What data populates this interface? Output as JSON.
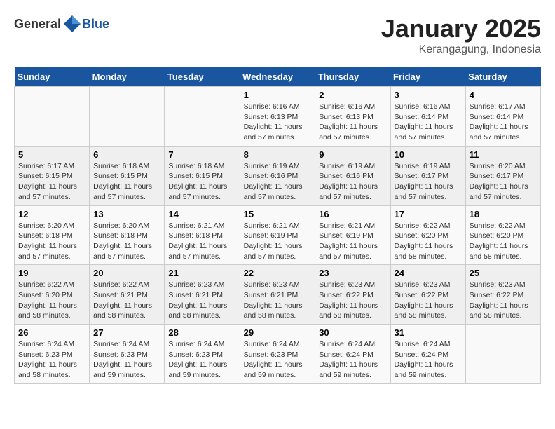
{
  "logo": {
    "general": "General",
    "blue": "Blue"
  },
  "title": "January 2025",
  "subtitle": "Kerangagung, Indonesia",
  "days_of_week": [
    "Sunday",
    "Monday",
    "Tuesday",
    "Wednesday",
    "Thursday",
    "Friday",
    "Saturday"
  ],
  "weeks": [
    [
      {
        "day": "",
        "sunrise": "",
        "sunset": "",
        "daylight": ""
      },
      {
        "day": "",
        "sunrise": "",
        "sunset": "",
        "daylight": ""
      },
      {
        "day": "",
        "sunrise": "",
        "sunset": "",
        "daylight": ""
      },
      {
        "day": "1",
        "sunrise": "Sunrise: 6:16 AM",
        "sunset": "Sunset: 6:13 PM",
        "daylight": "Daylight: 11 hours and 57 minutes."
      },
      {
        "day": "2",
        "sunrise": "Sunrise: 6:16 AM",
        "sunset": "Sunset: 6:13 PM",
        "daylight": "Daylight: 11 hours and 57 minutes."
      },
      {
        "day": "3",
        "sunrise": "Sunrise: 6:16 AM",
        "sunset": "Sunset: 6:14 PM",
        "daylight": "Daylight: 11 hours and 57 minutes."
      },
      {
        "day": "4",
        "sunrise": "Sunrise: 6:17 AM",
        "sunset": "Sunset: 6:14 PM",
        "daylight": "Daylight: 11 hours and 57 minutes."
      }
    ],
    [
      {
        "day": "5",
        "sunrise": "Sunrise: 6:17 AM",
        "sunset": "Sunset: 6:15 PM",
        "daylight": "Daylight: 11 hours and 57 minutes."
      },
      {
        "day": "6",
        "sunrise": "Sunrise: 6:18 AM",
        "sunset": "Sunset: 6:15 PM",
        "daylight": "Daylight: 11 hours and 57 minutes."
      },
      {
        "day": "7",
        "sunrise": "Sunrise: 6:18 AM",
        "sunset": "Sunset: 6:15 PM",
        "daylight": "Daylight: 11 hours and 57 minutes."
      },
      {
        "day": "8",
        "sunrise": "Sunrise: 6:19 AM",
        "sunset": "Sunset: 6:16 PM",
        "daylight": "Daylight: 11 hours and 57 minutes."
      },
      {
        "day": "9",
        "sunrise": "Sunrise: 6:19 AM",
        "sunset": "Sunset: 6:16 PM",
        "daylight": "Daylight: 11 hours and 57 minutes."
      },
      {
        "day": "10",
        "sunrise": "Sunrise: 6:19 AM",
        "sunset": "Sunset: 6:17 PM",
        "daylight": "Daylight: 11 hours and 57 minutes."
      },
      {
        "day": "11",
        "sunrise": "Sunrise: 6:20 AM",
        "sunset": "Sunset: 6:17 PM",
        "daylight": "Daylight: 11 hours and 57 minutes."
      }
    ],
    [
      {
        "day": "12",
        "sunrise": "Sunrise: 6:20 AM",
        "sunset": "Sunset: 6:18 PM",
        "daylight": "Daylight: 11 hours and 57 minutes."
      },
      {
        "day": "13",
        "sunrise": "Sunrise: 6:20 AM",
        "sunset": "Sunset: 6:18 PM",
        "daylight": "Daylight: 11 hours and 57 minutes."
      },
      {
        "day": "14",
        "sunrise": "Sunrise: 6:21 AM",
        "sunset": "Sunset: 6:18 PM",
        "daylight": "Daylight: 11 hours and 57 minutes."
      },
      {
        "day": "15",
        "sunrise": "Sunrise: 6:21 AM",
        "sunset": "Sunset: 6:19 PM",
        "daylight": "Daylight: 11 hours and 57 minutes."
      },
      {
        "day": "16",
        "sunrise": "Sunrise: 6:21 AM",
        "sunset": "Sunset: 6:19 PM",
        "daylight": "Daylight: 11 hours and 57 minutes."
      },
      {
        "day": "17",
        "sunrise": "Sunrise: 6:22 AM",
        "sunset": "Sunset: 6:20 PM",
        "daylight": "Daylight: 11 hours and 58 minutes."
      },
      {
        "day": "18",
        "sunrise": "Sunrise: 6:22 AM",
        "sunset": "Sunset: 6:20 PM",
        "daylight": "Daylight: 11 hours and 58 minutes."
      }
    ],
    [
      {
        "day": "19",
        "sunrise": "Sunrise: 6:22 AM",
        "sunset": "Sunset: 6:20 PM",
        "daylight": "Daylight: 11 hours and 58 minutes."
      },
      {
        "day": "20",
        "sunrise": "Sunrise: 6:22 AM",
        "sunset": "Sunset: 6:21 PM",
        "daylight": "Daylight: 11 hours and 58 minutes."
      },
      {
        "day": "21",
        "sunrise": "Sunrise: 6:23 AM",
        "sunset": "Sunset: 6:21 PM",
        "daylight": "Daylight: 11 hours and 58 minutes."
      },
      {
        "day": "22",
        "sunrise": "Sunrise: 6:23 AM",
        "sunset": "Sunset: 6:21 PM",
        "daylight": "Daylight: 11 hours and 58 minutes."
      },
      {
        "day": "23",
        "sunrise": "Sunrise: 6:23 AM",
        "sunset": "Sunset: 6:22 PM",
        "daylight": "Daylight: 11 hours and 58 minutes."
      },
      {
        "day": "24",
        "sunrise": "Sunrise: 6:23 AM",
        "sunset": "Sunset: 6:22 PM",
        "daylight": "Daylight: 11 hours and 58 minutes."
      },
      {
        "day": "25",
        "sunrise": "Sunrise: 6:23 AM",
        "sunset": "Sunset: 6:22 PM",
        "daylight": "Daylight: 11 hours and 58 minutes."
      }
    ],
    [
      {
        "day": "26",
        "sunrise": "Sunrise: 6:24 AM",
        "sunset": "Sunset: 6:23 PM",
        "daylight": "Daylight: 11 hours and 58 minutes."
      },
      {
        "day": "27",
        "sunrise": "Sunrise: 6:24 AM",
        "sunset": "Sunset: 6:23 PM",
        "daylight": "Daylight: 11 hours and 59 minutes."
      },
      {
        "day": "28",
        "sunrise": "Sunrise: 6:24 AM",
        "sunset": "Sunset: 6:23 PM",
        "daylight": "Daylight: 11 hours and 59 minutes."
      },
      {
        "day": "29",
        "sunrise": "Sunrise: 6:24 AM",
        "sunset": "Sunset: 6:23 PM",
        "daylight": "Daylight: 11 hours and 59 minutes."
      },
      {
        "day": "30",
        "sunrise": "Sunrise: 6:24 AM",
        "sunset": "Sunset: 6:24 PM",
        "daylight": "Daylight: 11 hours and 59 minutes."
      },
      {
        "day": "31",
        "sunrise": "Sunrise: 6:24 AM",
        "sunset": "Sunset: 6:24 PM",
        "daylight": "Daylight: 11 hours and 59 minutes."
      },
      {
        "day": "",
        "sunrise": "",
        "sunset": "",
        "daylight": ""
      }
    ]
  ]
}
